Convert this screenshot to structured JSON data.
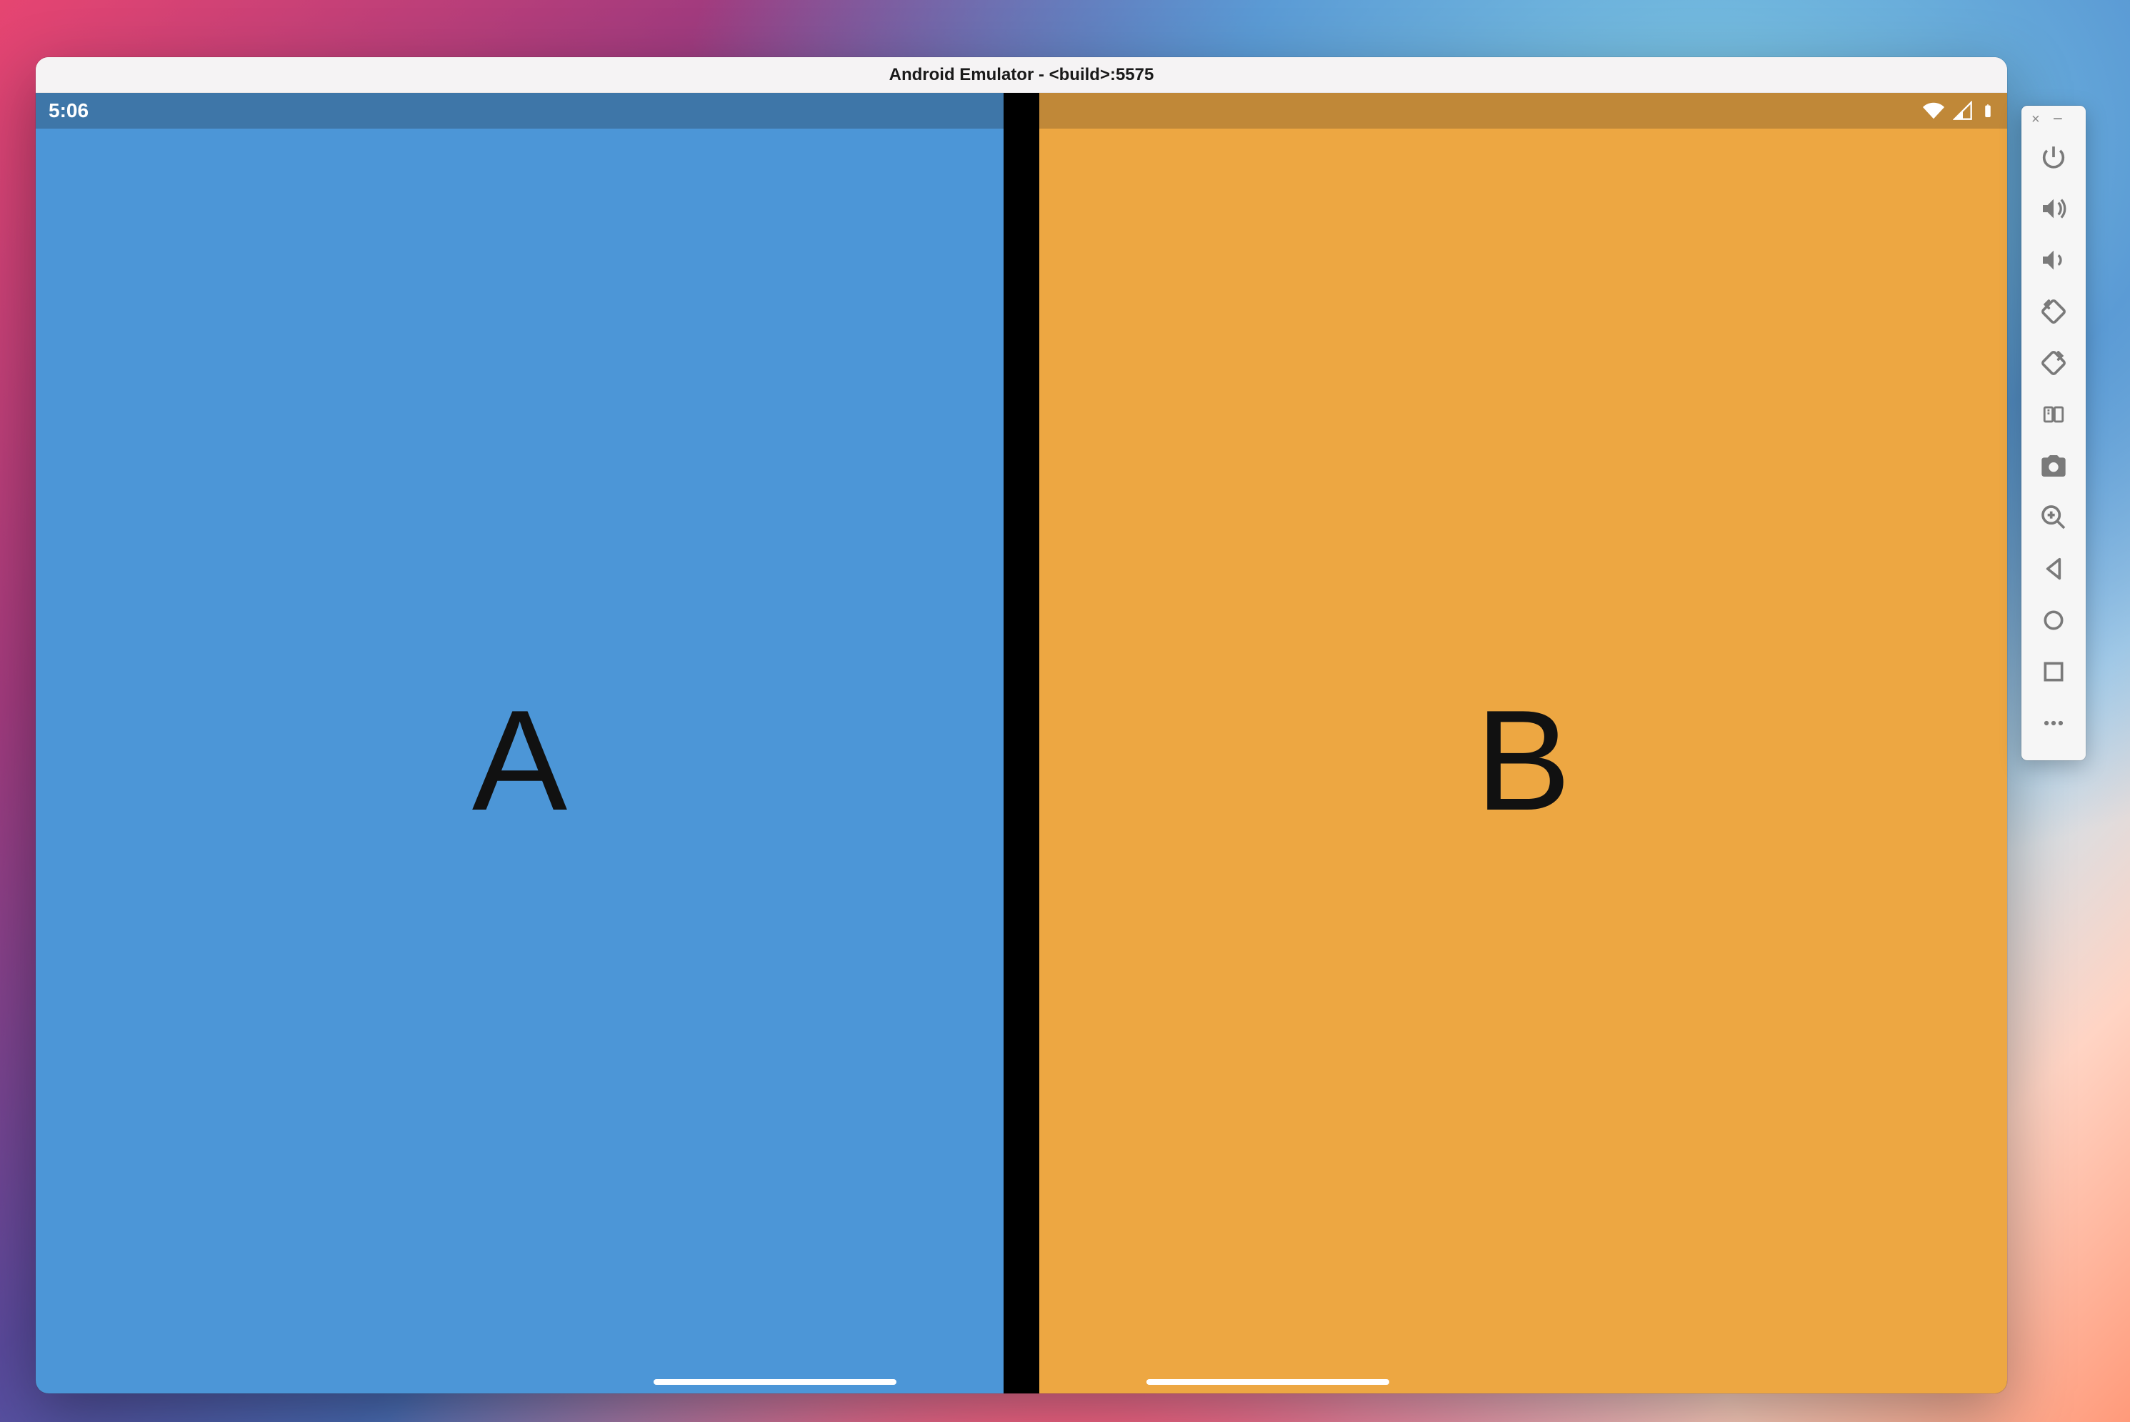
{
  "window": {
    "title": "Android Emulator - <build>:5575"
  },
  "statusbar": {
    "time": "5:06"
  },
  "panes": {
    "left": {
      "letter": "A",
      "bg": "#4c96d7",
      "status_bg": "#3e76a8"
    },
    "right": {
      "letter": "B",
      "bg": "#eda742",
      "status_bg": "#c08838"
    }
  },
  "toolbar": {
    "close": "close-icon",
    "minimize": "minimize-icon",
    "buttons": [
      {
        "name": "power-icon"
      },
      {
        "name": "volume-up-icon"
      },
      {
        "name": "volume-down-icon"
      },
      {
        "name": "rotate-left-icon"
      },
      {
        "name": "rotate-right-icon"
      },
      {
        "name": "fold-icon"
      },
      {
        "name": "screenshot-icon"
      },
      {
        "name": "zoom-icon"
      },
      {
        "name": "back-icon"
      },
      {
        "name": "home-icon"
      },
      {
        "name": "overview-icon"
      },
      {
        "name": "more-icon"
      }
    ]
  }
}
